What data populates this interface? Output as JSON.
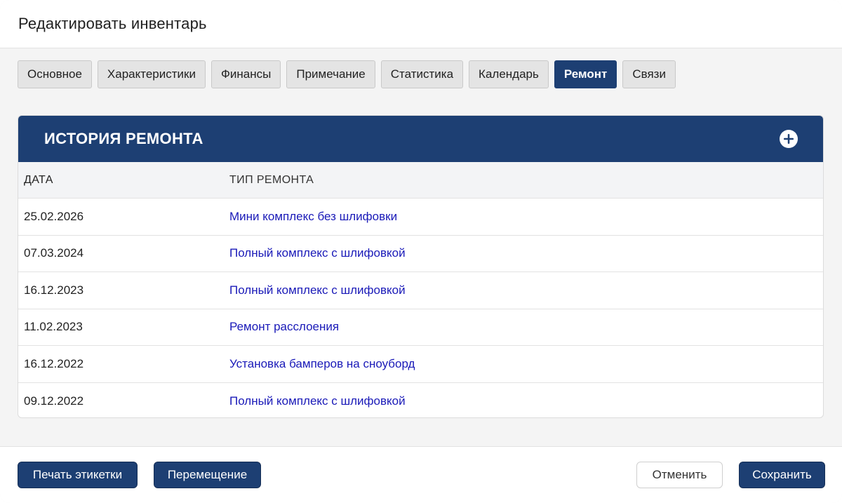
{
  "dialog": {
    "title": "Редактировать инвентарь"
  },
  "tabs": [
    {
      "label": "Основное",
      "active": false
    },
    {
      "label": "Характеристики",
      "active": false
    },
    {
      "label": "Финансы",
      "active": false
    },
    {
      "label": "Примечание",
      "active": false
    },
    {
      "label": "Статистика",
      "active": false
    },
    {
      "label": "Календарь",
      "active": false
    },
    {
      "label": "Ремонт",
      "active": true
    },
    {
      "label": "Связи",
      "active": false
    }
  ],
  "repair_history": {
    "title": "ИСТОРИЯ РЕМОНТА",
    "add_icon": "plus-circle-icon",
    "columns": {
      "date": "ДАТА",
      "type": "ТИП РЕМОНТА"
    },
    "rows": [
      {
        "date": "25.02.2026",
        "type": "Мини комплекс без шлифовки"
      },
      {
        "date": "07.03.2024",
        "type": "Полный комплекс с шлифовкой"
      },
      {
        "date": "16.12.2023",
        "type": "Полный комплекс с шлифовкой"
      },
      {
        "date": "11.02.2023",
        "type": "Ремонт расслоения"
      },
      {
        "date": "16.12.2022",
        "type": "Установка бамперов на сноуборд"
      },
      {
        "date": "09.12.2022",
        "type": "Полный комплекс с шлифовкой"
      }
    ]
  },
  "footer": {
    "print_label": "Печать этикетки",
    "move_label": "Перемещение",
    "cancel_label": "Отменить",
    "save_label": "Сохранить"
  },
  "colors": {
    "primary": "#1d3f73",
    "link": "#1a1ab8"
  }
}
